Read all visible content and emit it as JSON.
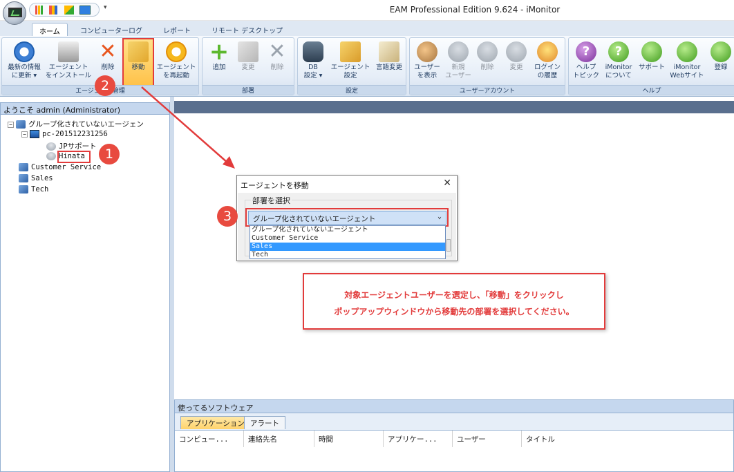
{
  "window": {
    "title": "EAM Professional Edition 9.624 - iMonitor"
  },
  "ribbon_tabs": [
    "ホーム",
    "コンピューターログ",
    "レポート",
    "リモート デスクトップ"
  ],
  "ribbon": {
    "groups": [
      {
        "label": "エージェント管理",
        "buttons": [
          "最新の情報\nに更新 ▾",
          "エージェント\nをインストール",
          "削除",
          "移動",
          "エージェント\nを再起動"
        ]
      },
      {
        "label": "部署",
        "buttons": [
          "追加",
          "変更",
          "削除"
        ]
      },
      {
        "label": "設定",
        "buttons": [
          "DB\n設定 ▾",
          "エージェント\n設定",
          "言語変更"
        ]
      },
      {
        "label": "ユーザーアカウント",
        "buttons": [
          "ユーザー\nを表示",
          "新規\nユーザー",
          "削除",
          "変更",
          "ログイン\nの履歴"
        ]
      },
      {
        "label": "ヘルプ",
        "buttons": [
          "ヘルプ\nトピック",
          "iMonitor\nについて",
          "サポート",
          "iMonitor\nWebサイト",
          "登録"
        ]
      }
    ]
  },
  "left_panel": {
    "header": "ようこそ admin (Administrator)",
    "tree": {
      "root": "グループ化されていないエージェン",
      "computer": "pc-201512231256",
      "users": [
        "JPサポート",
        "Hinata"
      ],
      "departments": [
        "Customer Service",
        "Sales",
        "Tech"
      ]
    }
  },
  "dialog": {
    "title": "エージェントを移動",
    "close": "✕",
    "group_label": "部署を選択",
    "selected": "グループ化されていないエージェント",
    "arrow": "⌄",
    "options": [
      "グループ化されていないエージェント",
      "Customer Service",
      "Sales",
      "Tech"
    ]
  },
  "callout": {
    "line1": "対象エージェントユーザーを選定し、「移動」をクリックし",
    "line2": "ポップアップウィンドウから移動先の部署を選択してください。"
  },
  "markers": [
    "1",
    "2",
    "3"
  ],
  "bottom_panel": {
    "header": "使ってるソフトウェア",
    "tabs": [
      "アプリケーション",
      "アラート"
    ],
    "columns": [
      "コンピュー...",
      "連絡先名",
      "時間",
      "アプリケー...",
      "ユーザー",
      "タイトル"
    ]
  }
}
